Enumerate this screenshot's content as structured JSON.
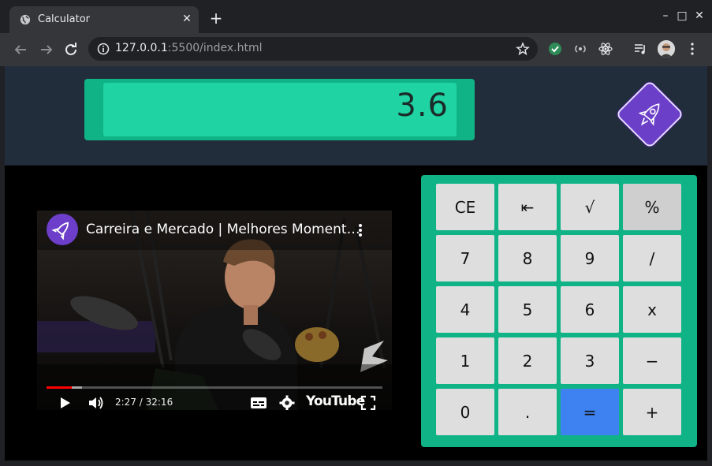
{
  "browser": {
    "tab_title": "Calculator",
    "new_tab_label": "+",
    "url_host": "127.0.0.1",
    "url_rest": ":5500/index.html",
    "window_controls": {
      "minimize": "–",
      "maximize": "□",
      "close": "✕"
    }
  },
  "calculator": {
    "display": "3.6",
    "keys": [
      [
        "CE",
        "⇤",
        "√",
        "%"
      ],
      [
        "7",
        "8",
        "9",
        "/"
      ],
      [
        "4",
        "5",
        "6",
        "x"
      ],
      [
        "1",
        "2",
        "3",
        "−"
      ],
      [
        "0",
        ".",
        "=",
        "+"
      ]
    ]
  },
  "video": {
    "title": "Carreira e Mercado | Melhores Moment…",
    "time": "2:27 / 32:16",
    "progress_fraction": 0.076,
    "buffer_fraction": 0.105,
    "platform": "YouTube"
  },
  "colors": {
    "accent": "#10b386",
    "display_bg": "#1fd3a2",
    "equals": "#3d82f0",
    "logo": "#6b3fc8",
    "header_band": "#222d3c"
  }
}
